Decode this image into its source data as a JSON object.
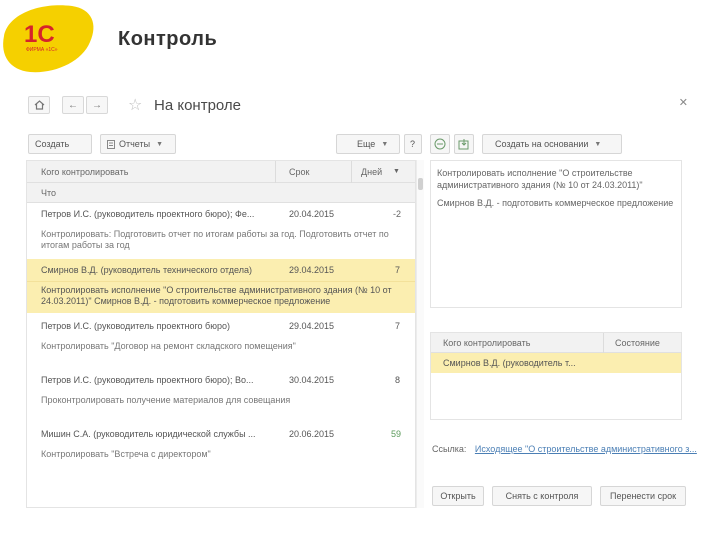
{
  "brand": {
    "logo_text": "1С",
    "logo_caption": "ФИРМА «1С»",
    "accent": "#f5d000",
    "logo_red": "#d6232b"
  },
  "page": {
    "heading": "Контроль"
  },
  "window": {
    "title": "На контроле",
    "nav": {
      "home_icon": "home-icon",
      "back_icon": "arrow-left-icon",
      "forward_icon": "arrow-right-icon",
      "favorite_icon": "star-icon"
    }
  },
  "toolbar": {
    "create_label": "Создать",
    "reports_label": "Отчеты",
    "more_label": "Еще",
    "help_label": "?",
    "create_based_label": "Создать на основании"
  },
  "grid": {
    "columns": {
      "who": "Кого контролировать",
      "deadline": "Срок",
      "days": "Дней",
      "what": "Что"
    },
    "rows": [
      {
        "who": "Петров И.С. (руководитель проектного бюро); Фе...",
        "deadline": "20.04.2015",
        "days": "-2",
        "what": "Контролировать: Подготовить отчет по итогам работы за год. Подготовить отчет по итогам работы за год",
        "selected": false
      },
      {
        "who": "Смирнов В.Д. (руководитель технического отдела)",
        "deadline": "29.04.2015",
        "days": "7",
        "what": "Контролировать исполнение \"О строительстве административного здания (№ 10 от 24.03.2011)\" Смирнов В.Д. - подготовить коммерческое предложение",
        "selected": true
      },
      {
        "who": "Петров И.С. (руководитель проектного бюро)",
        "deadline": "29.04.2015",
        "days": "7",
        "what": "Контролировать \"Договор на ремонт складского помещения\"",
        "selected": false
      },
      {
        "who": "Петров И.С. (руководитель проектного бюро); Во...",
        "deadline": "30.04.2015",
        "days": "8",
        "what": "Проконтролировать получение материалов для совещания",
        "selected": false
      },
      {
        "who": "Мишин С.А. (руководитель юридической службы ...",
        "deadline": "20.06.2015",
        "days": "59",
        "what": "Контролировать \"Встреча с директором\"",
        "selected": false
      }
    ]
  },
  "details": {
    "text": "Контролировать исполнение \"О строительстве административного здания (№ 10 от 24.03.2011)\"",
    "note": "Смирнов В.Д. - подготовить коммерческое предложение"
  },
  "subgrid": {
    "columns": {
      "who": "Кого контролировать",
      "state": "Состояние"
    },
    "rows": [
      {
        "who": "Смирнов В.Д. (руководитель т...",
        "state": ""
      }
    ]
  },
  "link": {
    "label": "Ссылка:",
    "value": "Исходящее \"О строительстве административного з..."
  },
  "bottom_buttons": {
    "open": "Открыть",
    "remove": "Снять с контроля",
    "move": "Перенести срок"
  }
}
